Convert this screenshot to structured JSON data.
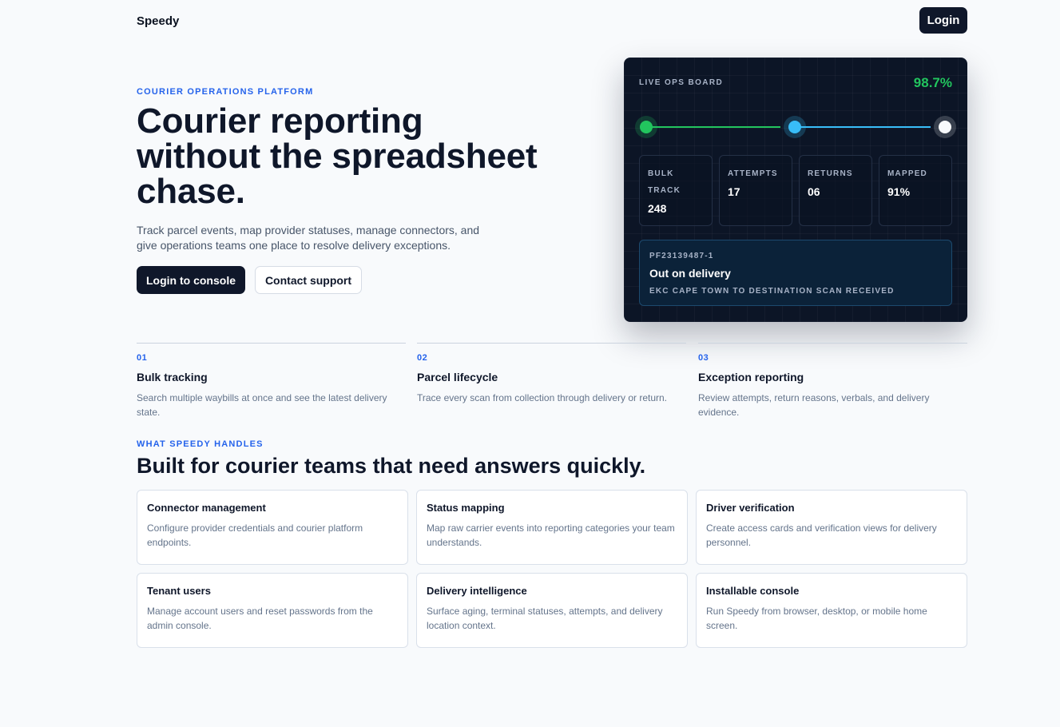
{
  "header": {
    "brand": "Speedy",
    "login_label": "Login"
  },
  "hero": {
    "eyebrow": "COURIER OPERATIONS PLATFORM",
    "title": "Courier reporting without the spreadsheet chase.",
    "description": "Track parcel events, map provider statuses, manage connectors, and give operations teams one place to resolve delivery exceptions.",
    "primary_cta": "Login to console",
    "secondary_cta": "Contact support"
  },
  "board": {
    "label": "LIVE OPS BOARD",
    "percent": "98.7%",
    "stats": [
      {
        "label": "BULK TRACK",
        "value": "248"
      },
      {
        "label": "ATTEMPTS",
        "value": "17"
      },
      {
        "label": "RETURNS",
        "value": "06"
      },
      {
        "label": "MAPPED",
        "value": "91%"
      }
    ],
    "parcel": {
      "id": "PF23139487-1",
      "status": "Out on delivery",
      "note": "EKC CAPE TOWN TO DESTINATION SCAN RECEIVED"
    },
    "colors": {
      "delivered": "#22c55e",
      "transit": "#38bdf8",
      "pending": "#f8fafc"
    }
  },
  "steps": [
    {
      "num": "01",
      "title": "Bulk tracking",
      "desc": "Search multiple waybills at once and see the latest delivery state."
    },
    {
      "num": "02",
      "title": "Parcel lifecycle",
      "desc": "Trace every scan from collection through delivery or return."
    },
    {
      "num": "03",
      "title": "Exception reporting",
      "desc": "Review attempts, return reasons, verbals, and delivery evidence."
    }
  ],
  "features": {
    "eyebrow": "WHAT SPEEDY HANDLES",
    "title": "Built for courier teams that need answers quickly.",
    "cards": [
      {
        "title": "Connector management",
        "desc": "Configure provider credentials and courier platform endpoints."
      },
      {
        "title": "Status mapping",
        "desc": "Map raw carrier events into reporting categories your team understands."
      },
      {
        "title": "Driver verification",
        "desc": "Create access cards and verification views for delivery personnel."
      },
      {
        "title": "Tenant users",
        "desc": "Manage account users and reset passwords from the admin console."
      },
      {
        "title": "Delivery intelligence",
        "desc": "Surface aging, terminal statuses, attempts, and delivery location context."
      },
      {
        "title": "Installable console",
        "desc": "Run Speedy from browser, desktop, or mobile home screen."
      }
    ]
  },
  "theme": {
    "accent": "#2563eb",
    "ink": "#0f172a",
    "muted": "#64748b",
    "success": "#22c55e"
  }
}
